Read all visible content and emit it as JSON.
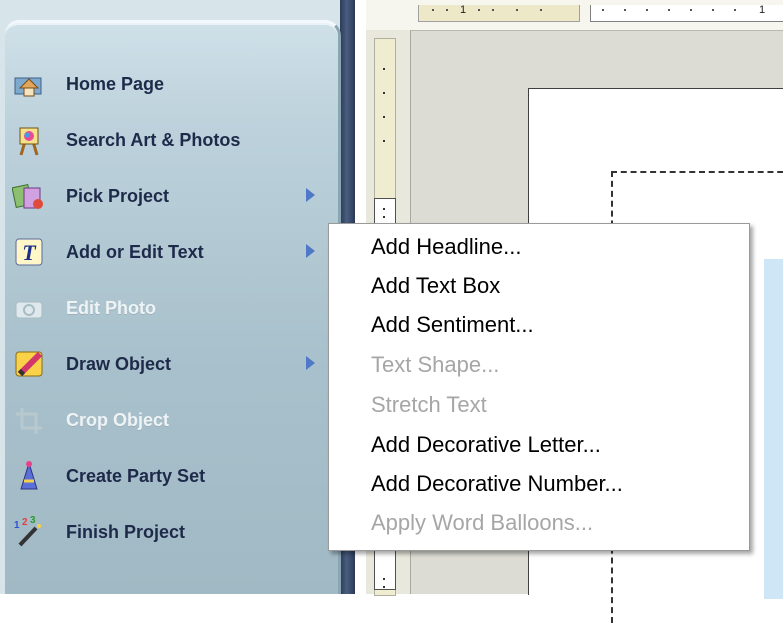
{
  "sidebar": {
    "items": [
      {
        "label": "Home Page",
        "icon": "home-page-icon",
        "disabled": false,
        "has_submenu": false
      },
      {
        "label": "Search Art & Photos",
        "icon": "art-easel-icon",
        "disabled": false,
        "has_submenu": false
      },
      {
        "label": "Pick Project",
        "icon": "pick-project-icon",
        "disabled": false,
        "has_submenu": true
      },
      {
        "label": "Add or Edit Text",
        "icon": "text-t-icon",
        "disabled": false,
        "has_submenu": true
      },
      {
        "label": "Edit Photo",
        "icon": "camera-icon",
        "disabled": true,
        "has_submenu": false
      },
      {
        "label": "Draw Object",
        "icon": "pencil-draw-icon",
        "disabled": false,
        "has_submenu": true
      },
      {
        "label": "Crop Object",
        "icon": "crop-icon",
        "disabled": true,
        "has_submenu": false
      },
      {
        "label": "Create Party Set",
        "icon": "party-hat-icon",
        "disabled": false,
        "has_submenu": false
      },
      {
        "label": "Finish Project",
        "icon": "magic-wand-icon",
        "disabled": false,
        "has_submenu": false
      }
    ]
  },
  "ruler": {
    "label_1": "1",
    "label_2": "1"
  },
  "submenu": {
    "items": [
      {
        "label": "Add Headline...",
        "disabled": false
      },
      {
        "label": "Add Text Box",
        "disabled": false
      },
      {
        "label": "Add Sentiment...",
        "disabled": false
      },
      {
        "label": "Text Shape...",
        "disabled": true
      },
      {
        "label": "Stretch Text",
        "disabled": true
      },
      {
        "label": "Add Decorative Letter...",
        "disabled": false
      },
      {
        "label": "Add Decorative Number...",
        "disabled": false
      },
      {
        "label": "Apply Word Balloons...",
        "disabled": true
      }
    ]
  },
  "colors": {
    "panel": "#a9c1cc",
    "panel_text": "#1e2a4a",
    "arrow": "#4f78c8",
    "disabled_text": "#a6a6a6"
  }
}
